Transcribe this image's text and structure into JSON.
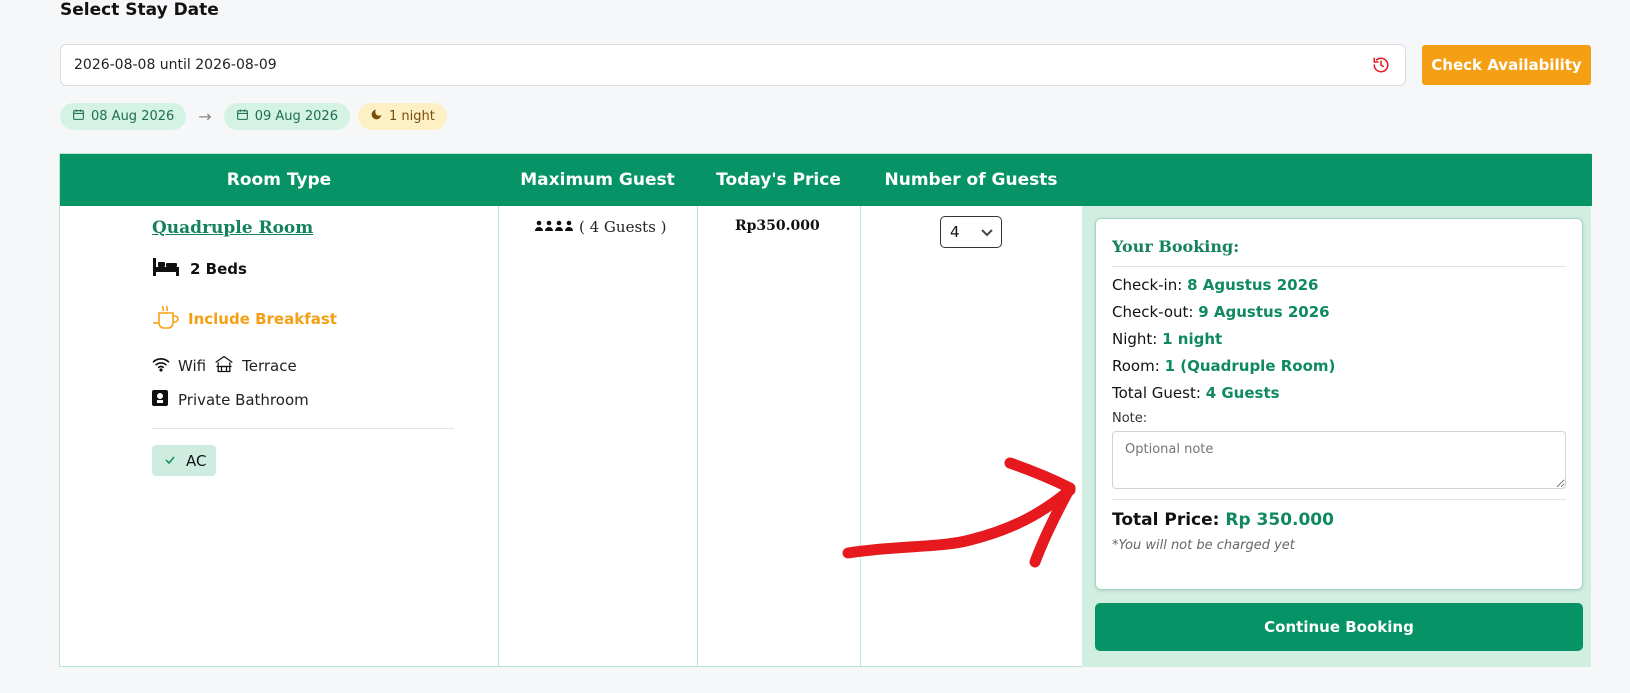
{
  "section_title": "Select Stay Date",
  "date_input": {
    "value": "2026-08-08 until 2026-08-09"
  },
  "check_availability_label": "Check Availability",
  "chips": {
    "checkin": "08 Aug 2026",
    "arrow": "→",
    "checkout": "09 Aug 2026",
    "nights": "1 night"
  },
  "table": {
    "headers": [
      "Room Type",
      "Maximum Guest",
      "Today's Price",
      "Number of Guests"
    ],
    "room": {
      "name": "Quadruple Room",
      "beds": "2 Beds",
      "breakfast": "Include Breakfast",
      "amenity_wifi": "Wifi",
      "amenity_terrace": "Terrace",
      "amenity_bathroom": "Private Bathroom",
      "badge_ac": "AC"
    },
    "max_guest": "( 4 Guests )",
    "price": "Rp350.000",
    "guest_count": "4"
  },
  "booking": {
    "title": "Your Booking:",
    "checkin_label": "Check-in:",
    "checkin_value": "8 Agustus 2026",
    "checkout_label": "Check-out:",
    "checkout_value": "9 Agustus 2026",
    "night_label": "Night:",
    "night_value": "1 night",
    "room_label": "Room:",
    "room_value": "1 (Quadruple Room)",
    "guest_label": "Total Guest:",
    "guest_value": "4 Guests",
    "note_label": "Note:",
    "note_placeholder": "Optional note",
    "total_label": "Total Price:",
    "total_value": "Rp 350.000",
    "charge_note": "*You will not be charged yet"
  },
  "continue_label": "Continue Booking",
  "colors": {
    "primary": "#069467",
    "accent": "#f5a014",
    "annotation": "#e5191e"
  }
}
